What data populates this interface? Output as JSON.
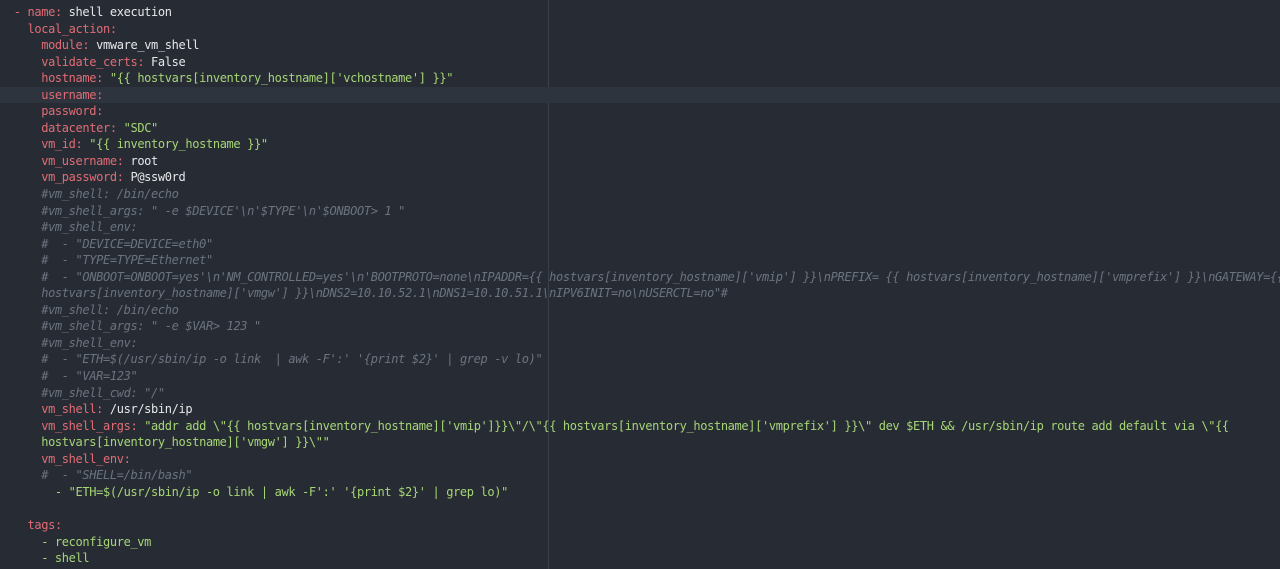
{
  "editor": {
    "language": "yaml",
    "colors": {
      "background": "#272c34",
      "current_line": "#2e343e",
      "key": "#e06c75",
      "value": "#e6e7ea",
      "string": "#a6d576",
      "comment": "#6b7380"
    },
    "current_line_index": 5,
    "lines": [
      {
        "indent": "  ",
        "dash": "- ",
        "key": "name",
        "sep": ": ",
        "value": "shell execution",
        "vtype": "v"
      },
      {
        "indent": "    ",
        "dash": "",
        "key": "local_action",
        "sep": ":",
        "value": "",
        "vtype": "v"
      },
      {
        "indent": "      ",
        "dash": "",
        "key": "module",
        "sep": ": ",
        "value": "vmware_vm_shell",
        "vtype": "v"
      },
      {
        "indent": "      ",
        "dash": "",
        "key": "validate_certs",
        "sep": ": ",
        "value": "False",
        "vtype": "v"
      },
      {
        "indent": "      ",
        "dash": "",
        "key": "hostname",
        "sep": ": ",
        "value": "\"{{ hostvars[inventory_hostname]['vchostname'] }}\"",
        "vtype": "s"
      },
      {
        "indent": "      ",
        "dash": "",
        "key": "username",
        "sep": ":",
        "value": "",
        "vtype": "v"
      },
      {
        "indent": "      ",
        "dash": "",
        "key": "password",
        "sep": ":",
        "value": "",
        "vtype": "v"
      },
      {
        "indent": "      ",
        "dash": "",
        "key": "datacenter",
        "sep": ": ",
        "value": "\"SDC\"",
        "vtype": "s"
      },
      {
        "indent": "      ",
        "dash": "",
        "key": "vm_id",
        "sep": ": ",
        "value": "\"{{ inventory_hostname }}\"",
        "vtype": "s"
      },
      {
        "indent": "      ",
        "dash": "",
        "key": "vm_username",
        "sep": ": ",
        "value": "root",
        "vtype": "v"
      },
      {
        "indent": "      ",
        "dash": "",
        "key": "vm_password",
        "sep": ": ",
        "value": "P@ssw0rd",
        "vtype": "v"
      },
      {
        "indent": "      ",
        "comment": "#vm_shell: /bin/echo"
      },
      {
        "indent": "      ",
        "comment": "#vm_shell_args: \" -e $DEVICE'\\n'$TYPE'\\n'$ONBOOT> 1 \""
      },
      {
        "indent": "      ",
        "comment": "#vm_shell_env:"
      },
      {
        "indent": "      ",
        "comment": "#  - \"DEVICE=DEVICE=eth0\""
      },
      {
        "indent": "      ",
        "comment": "#  - \"TYPE=TYPE=Ethernet\""
      },
      {
        "indent": "      ",
        "comment": "#  - \"ONBOOT=ONBOOT=yes'\\n'NM_CONTROLLED=yes'\\n'BOOTPROTO=none\\nIPADDR={{ hostvars[inventory_hostname]['vmip'] }}\\nPREFIX= {{ hostvars[inventory_hostname]['vmprefix'] }}\\nGATEWAY={{"
      },
      {
        "indent": "      ",
        "comment": "hostvars[inventory_hostname]['vmgw'] }}\\nDNS2=10.10.52.1\\nDNS1=10.10.51.1\\nIPV6INIT=no\\nUSERCTL=no\"#"
      },
      {
        "indent": "      ",
        "comment": "#vm_shell: /bin/echo"
      },
      {
        "indent": "      ",
        "comment": "#vm_shell_args: \" -e $VAR> 123 \""
      },
      {
        "indent": "      ",
        "comment": "#vm_shell_env:"
      },
      {
        "indent": "      ",
        "comment": "#  - \"ETH=$(/usr/sbin/ip -o link  | awk -F':' '{print $2}' | grep -v lo)\""
      },
      {
        "indent": "      ",
        "comment": "#  - \"VAR=123\""
      },
      {
        "indent": "      ",
        "comment": "#vm_shell_cwd: \"/\""
      },
      {
        "indent": "      ",
        "dash": "",
        "key": "vm_shell",
        "sep": ": ",
        "value": "/usr/sbin/ip",
        "vtype": "v"
      },
      {
        "indent": "      ",
        "dash": "",
        "key": "vm_shell_args",
        "sep": ": ",
        "value": "\"addr add \\\"{{ hostvars[inventory_hostname]['vmip']}}\\\"/\\\"{{ hostvars[inventory_hostname]['vmprefix'] }}\\\" dev $ETH && /usr/sbin/ip route add default via \\\"{{",
        "vtype": "s"
      },
      {
        "indent": "      ",
        "text": "hostvars[inventory_hostname]['vmgw'] }}\\\"\"",
        "vtype": "s"
      },
      {
        "indent": "      ",
        "dash": "",
        "key": "vm_shell_env",
        "sep": ":",
        "value": "",
        "vtype": "v"
      },
      {
        "indent": "      ",
        "comment": "#  - \"SHELL=/bin/bash\""
      },
      {
        "indent": "        ",
        "text": "- \"ETH=$(/usr/sbin/ip -o link | awk -F':' '{print $2}' | grep lo)\"",
        "vtype": "s"
      },
      {
        "indent": "",
        "text": "",
        "vtype": "v"
      },
      {
        "indent": "    ",
        "dash": "",
        "key": "tags",
        "sep": ":",
        "value": "",
        "vtype": "v"
      },
      {
        "indent": "      ",
        "text": "- reconfigure_vm",
        "vtype": "s"
      },
      {
        "indent": "      ",
        "text": "- shell",
        "vtype": "s"
      }
    ]
  }
}
